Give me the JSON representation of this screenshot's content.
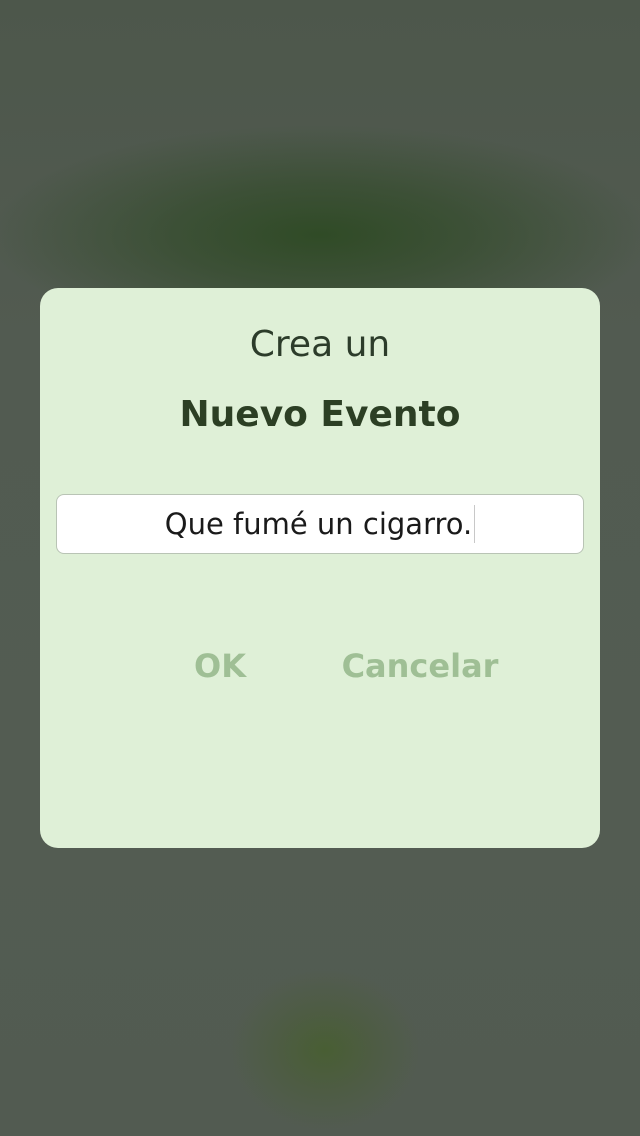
{
  "dialog": {
    "subtitle": "Crea un",
    "title": "Nuevo Evento",
    "input_value": "Que fumé un cigarro.",
    "ok_label": "OK",
    "cancel_label": "Cancelar"
  },
  "colors": {
    "dialog_background": "#dff0d7",
    "title_text": "#2c3f24",
    "button_text": "#9fbf95",
    "backdrop": "#505a4f"
  }
}
